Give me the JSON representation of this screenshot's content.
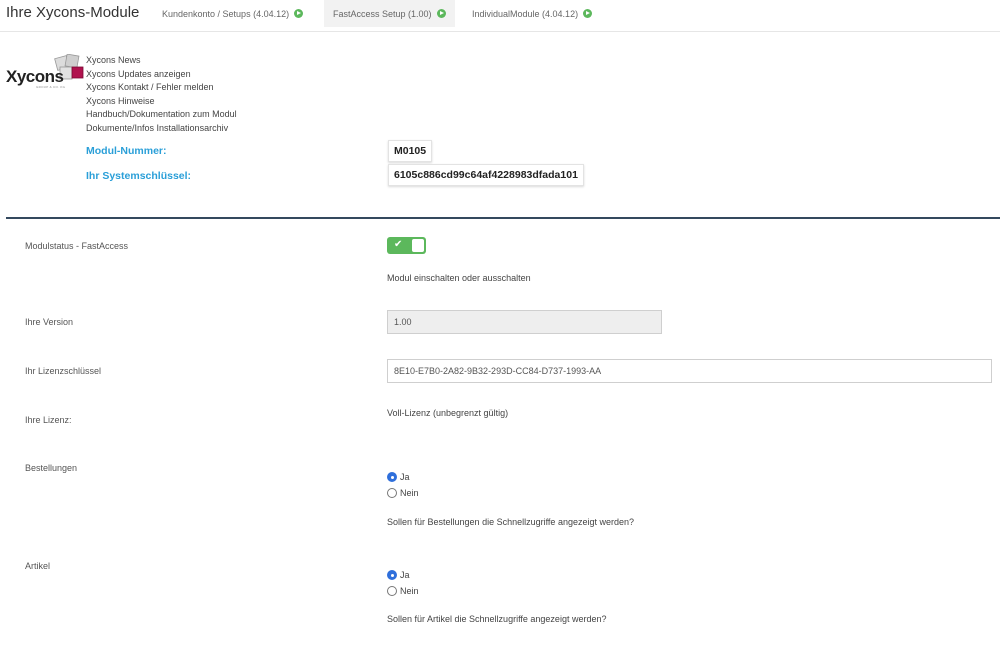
{
  "header": {
    "title": "Ihre Xycons-Module",
    "tabs": [
      {
        "label": "Kundenkonto / Setups (4.04.12)"
      },
      {
        "label": "FastAccess Setup (1.00)"
      },
      {
        "label": "IndividualModule (4.04.12)"
      }
    ]
  },
  "logo": {
    "text": "Xycons",
    "sub": "GROUP & CO. KG"
  },
  "links": [
    "Xycons News",
    "Xycons Updates anzeigen",
    "Xycons Kontakt / Fehler melden",
    "Xycons Hinweise",
    "Handbuch/Dokumentation zum Modul",
    "Dokumente/Infos Installationsarchiv"
  ],
  "info": {
    "module_number_label": "Modul-Nummer:",
    "module_number": "M0105",
    "system_key_label": "Ihr Systemschlüssel:",
    "system_key": "6105c886cd99c64af4228983dfada101"
  },
  "settings": {
    "status": {
      "label": "Modulstatus - FastAccess",
      "check": "✔",
      "help": "Modul einschalten oder ausschalten"
    },
    "version": {
      "label": "Ihre Version",
      "value": "1.00"
    },
    "license_key": {
      "label": "Ihr Lizenzschlüssel",
      "value": "8E10-E7B0-2A82-9B32-293D-CC84-D737-1993-AA"
    },
    "license": {
      "label": "Ihre Lizenz:",
      "value": "Voll-Lizenz (unbegrenzt gültig)"
    },
    "orders": {
      "label": "Bestellungen",
      "yes": "Ja",
      "no": "Nein",
      "help": "Sollen für Bestellungen die Schnellzugriffe angezeigt werden?"
    },
    "articles": {
      "label": "Artikel",
      "yes": "Ja",
      "no": "Nein",
      "help": "Sollen für Artikel die Schnellzugriffe angezeigt werden?"
    }
  },
  "colors": {
    "accent": "#2a9fd8",
    "toggle_on": "#5cb85c",
    "divider": "#34495e"
  }
}
